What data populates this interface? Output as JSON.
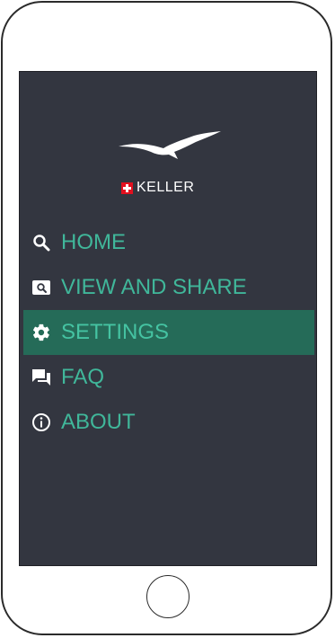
{
  "brand": {
    "name": "KELLER",
    "flag_color": "#e3101f"
  },
  "menu": {
    "items": [
      {
        "label": "HOME",
        "icon": "search-icon",
        "active": false
      },
      {
        "label": "VIEW AND SHARE",
        "icon": "view-icon",
        "active": false
      },
      {
        "label": "SETTINGS",
        "icon": "gear-icon",
        "active": true
      },
      {
        "label": "FAQ",
        "icon": "chat-icon",
        "active": false
      },
      {
        "label": "ABOUT",
        "icon": "info-icon",
        "active": false
      }
    ]
  },
  "colors": {
    "screen_bg": "#333640",
    "accent": "#40b79a",
    "active_bg": "#256b58"
  }
}
